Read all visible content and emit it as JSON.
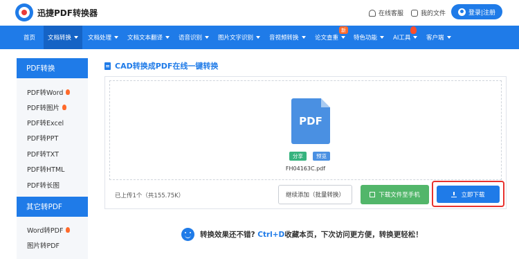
{
  "header": {
    "brand": "迅捷PDF转换器",
    "support": "在线客服",
    "my_files": "我的文件",
    "login": "登录|注册"
  },
  "nav": {
    "items": [
      "首页",
      "文档转换",
      "文档处理",
      "文档文本翻译",
      "语音识别",
      "图片文字识别",
      "音视频转换",
      "论文查重",
      "特色功能",
      "AI工具",
      "客户端"
    ],
    "badge": "新"
  },
  "sidebar": {
    "section1": "PDF转换",
    "items1": [
      "PDF转Word",
      "PDF转图片",
      "PDF转Excel",
      "PDF转PPT",
      "PDF转TXT",
      "PDF转HTML",
      "PDF转长图"
    ],
    "section2": "其它转PDF",
    "items2": [
      "Word转PDF",
      "图片转PDF"
    ]
  },
  "main": {
    "title": "CAD转换成PDF在线一键转换",
    "file_icon_text": "PDF",
    "share": "分享",
    "preview": "预览",
    "filename": "FH04163C.pdf",
    "upload_info": "已上传1个（共155.75K）",
    "continue_btn": "继续添加（批量转换）",
    "phone_btn": "下载文件至手机",
    "download_btn": "立即下载"
  },
  "tip": {
    "part1": "转换效果还不错?",
    "shortcut": "Ctrl+D",
    "part2": "收藏本页，下次访问更方便，转换更轻松！"
  },
  "colors": {
    "accent": "#1f7be8",
    "highlight_border": "#e8322e",
    "green": "#52b66a"
  }
}
